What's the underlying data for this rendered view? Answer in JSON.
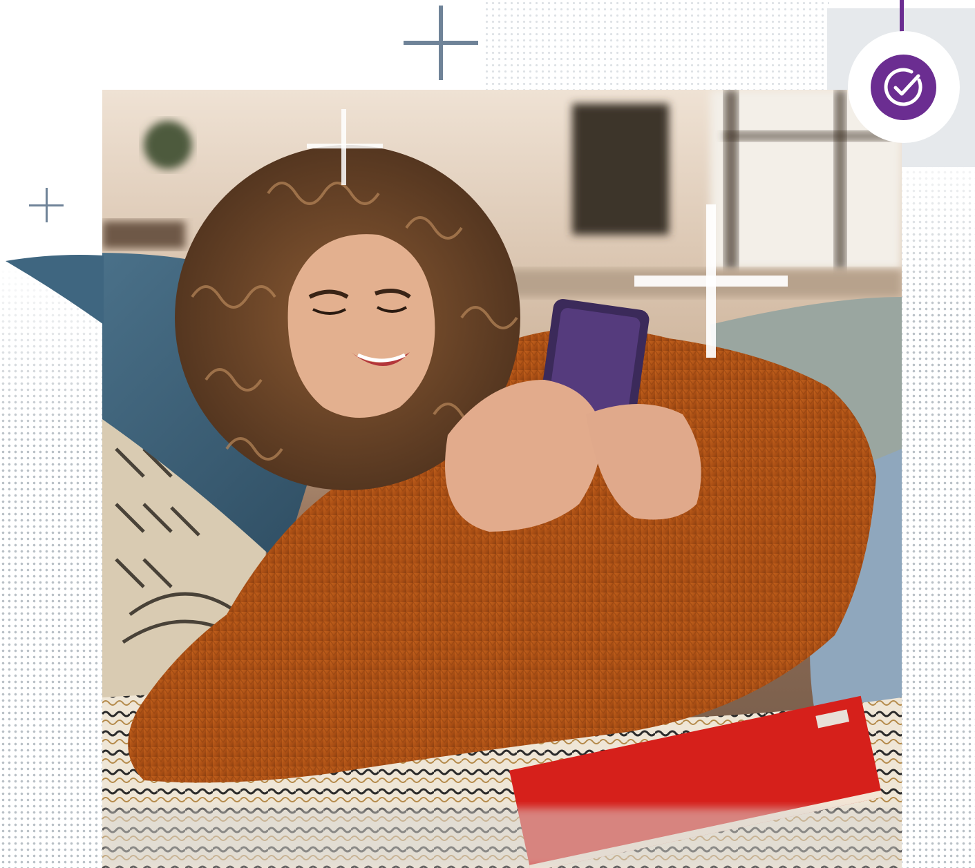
{
  "colors": {
    "accent_purple": "#6b2d91",
    "plus_slate": "#6f8398",
    "panel_grey": "#e6e9ec",
    "halftone_grey": "#b9c0c6"
  },
  "icons": {
    "badge": "check-circle-icon",
    "decor": "plus-sign-icon"
  },
  "photo": {
    "subject": "",
    "alt": ""
  }
}
